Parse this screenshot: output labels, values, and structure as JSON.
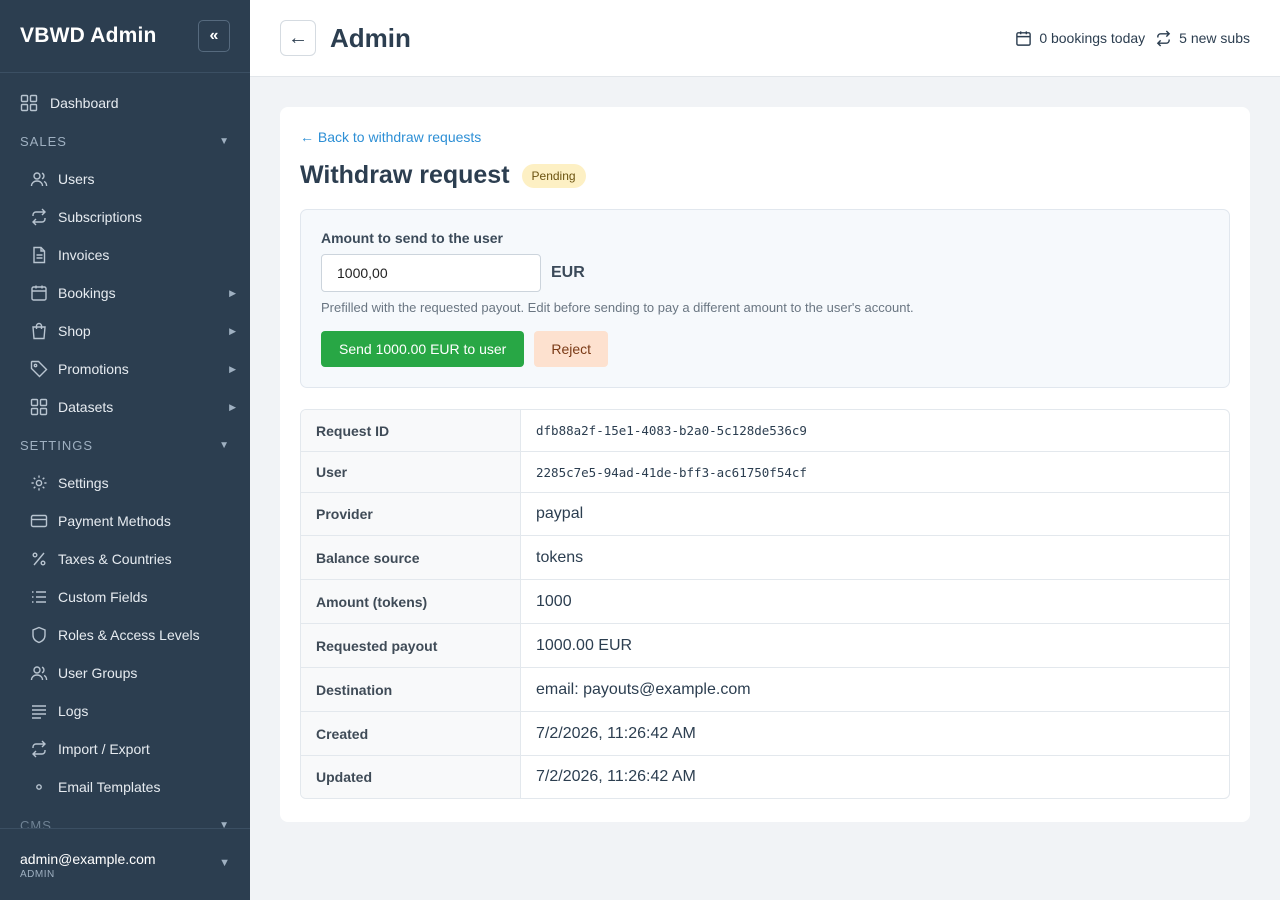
{
  "sidebar": {
    "brand": "VBWD Admin",
    "collapse_icon": "«",
    "dashboard": "Dashboard",
    "sections": [
      {
        "title": "SALES",
        "items": [
          {
            "label": "Users",
            "icon": "users-icon"
          },
          {
            "label": "Subscriptions",
            "icon": "repeat-icon"
          },
          {
            "label": "Invoices",
            "icon": "document-icon"
          },
          {
            "label": "Bookings",
            "icon": "calendar-icon",
            "submenu": true
          },
          {
            "label": "Shop",
            "icon": "bag-icon",
            "submenu": true
          },
          {
            "label": "Promotions",
            "icon": "tag-icon",
            "submenu": true
          },
          {
            "label": "Datasets",
            "icon": "grid-icon",
            "submenu": true
          }
        ]
      },
      {
        "title": "SETTINGS",
        "items": [
          {
            "label": "Settings",
            "icon": "gear-icon"
          },
          {
            "label": "Payment Methods",
            "icon": "credit-card-icon"
          },
          {
            "label": "Taxes & Countries",
            "icon": "percent-icon"
          },
          {
            "label": "Custom Fields",
            "icon": "list-icon"
          },
          {
            "label": "Roles & Access Levels",
            "icon": "shield-icon"
          },
          {
            "label": "User Groups",
            "icon": "users-icon"
          },
          {
            "label": "Logs",
            "icon": "lines-icon"
          },
          {
            "label": "Import / Export",
            "icon": "repeat-icon"
          },
          {
            "label": "Email Templates",
            "icon": "dot-icon"
          }
        ]
      }
    ],
    "cut_section": "CMS",
    "user": {
      "email": "admin@example.com",
      "role": "ADMIN"
    }
  },
  "header": {
    "back_icon": "←",
    "title": "Admin",
    "bookings_today": "0 bookings today",
    "new_subs": "5 new subs"
  },
  "main": {
    "back_link": "← Back to withdraw requests",
    "title": "Withdraw request",
    "status": "Pending",
    "amount_label": "Amount to send to the user",
    "amount_value": "1000,00",
    "currency": "EUR",
    "hint": "Prefilled with the requested payout. Edit before sending to pay a different amount to the user's account.",
    "send_button": "Send 1000.00 EUR to user",
    "reject_button": "Reject",
    "details": [
      {
        "key": "Request ID",
        "value": "dfb88a2f-15e1-4083-b2a0-5c128de536c9"
      },
      {
        "key": "User",
        "value": "2285c7e5-94ad-41de-bff3-ac61750f54cf"
      },
      {
        "key": "Provider",
        "value": "paypal"
      },
      {
        "key": "Balance source",
        "value": "tokens"
      },
      {
        "key": "Amount (tokens)",
        "value": "1000"
      },
      {
        "key": "Requested payout",
        "value": "1000.00 EUR"
      },
      {
        "key": "Destination",
        "value": "email: payouts@example.com"
      },
      {
        "key": "Created",
        "value": "7/2/2026, 11:26:42 AM"
      },
      {
        "key": "Updated",
        "value": "7/2/2026, 11:26:42 AM"
      }
    ]
  }
}
